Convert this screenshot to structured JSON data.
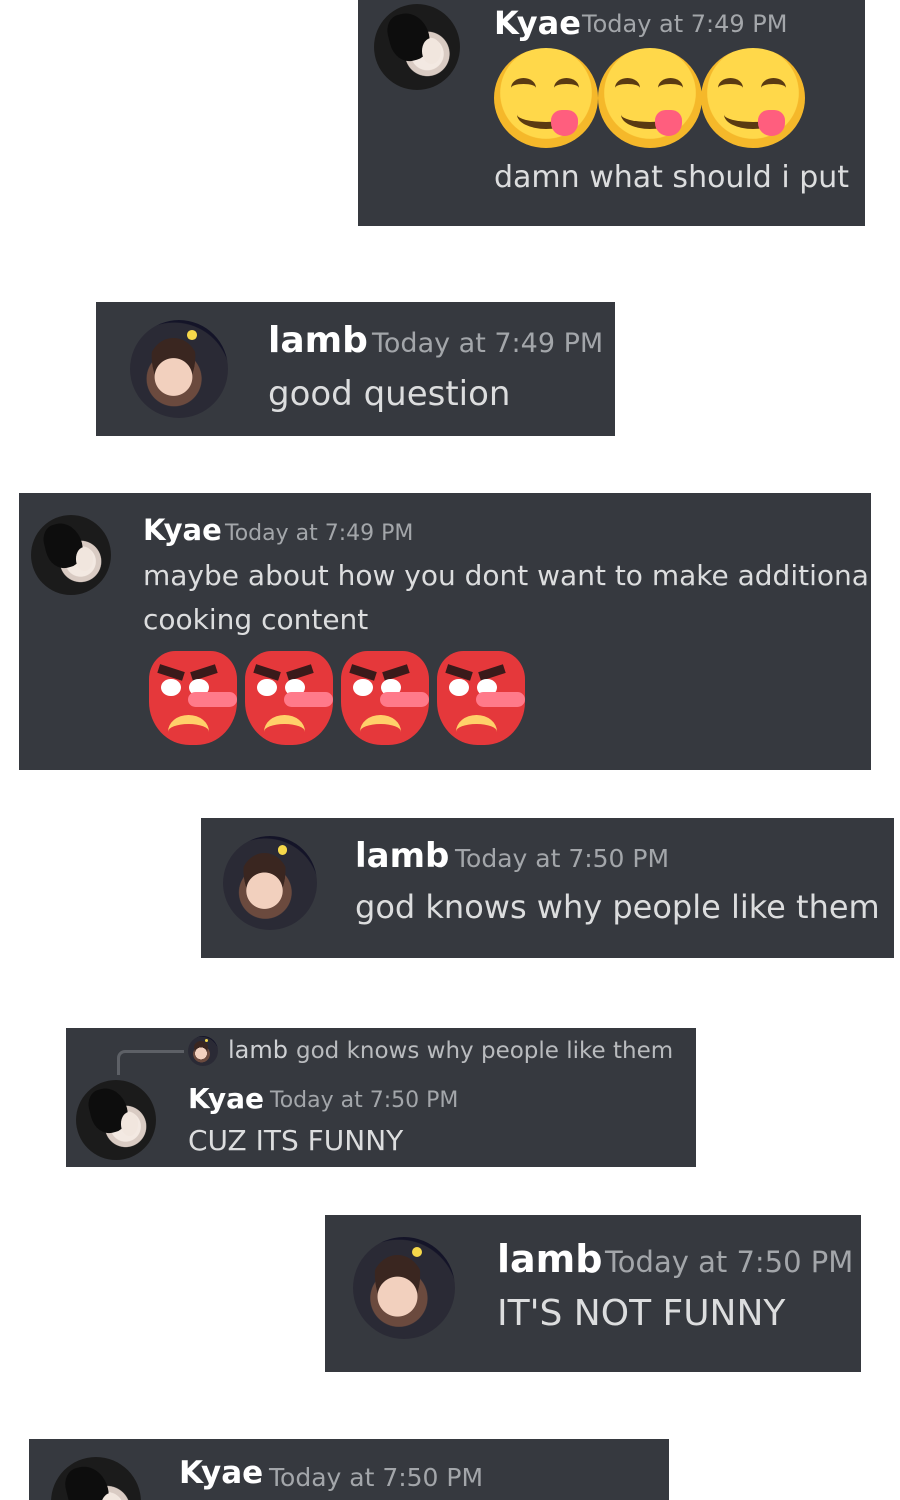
{
  "messages": [
    {
      "author": "Kyae",
      "time": "Today at 7:49 PM",
      "emoji": [
        "yum",
        "yum",
        "yum"
      ],
      "text": "damn what should i put"
    },
    {
      "author": "lamb",
      "time": "Today at 7:49 PM",
      "text": "good question"
    },
    {
      "author": "Kyae",
      "time": "Today at 7:49 PM",
      "text_line1": "maybe about how you dont want to make additional",
      "text_line2": "cooking content",
      "emoji": [
        "tengu",
        "tengu",
        "tengu",
        "tengu"
      ]
    },
    {
      "author": "lamb",
      "time": "Today at 7:50 PM",
      "text": "god knows why people like them"
    },
    {
      "author": "Kyae",
      "time": "Today at 7:50 PM",
      "text": "CUZ ITS FUNNY",
      "reply": {
        "author": "lamb",
        "text": "god knows why people like them"
      }
    },
    {
      "author": "lamb",
      "time": "Today at 7:50 PM",
      "text": "IT'S NOT FUNNY"
    },
    {
      "author": "Kyae",
      "time": "Today at 7:50 PM"
    }
  ],
  "emoji_names": {
    "yum": "face-savoring-food",
    "tengu": "japanese-goblin"
  },
  "colors": {
    "card_bg": "#36393f",
    "username": "#ffffff",
    "timestamp": "#a3a6aa",
    "text": "#dcddde",
    "page_bg": "#ffffff"
  }
}
